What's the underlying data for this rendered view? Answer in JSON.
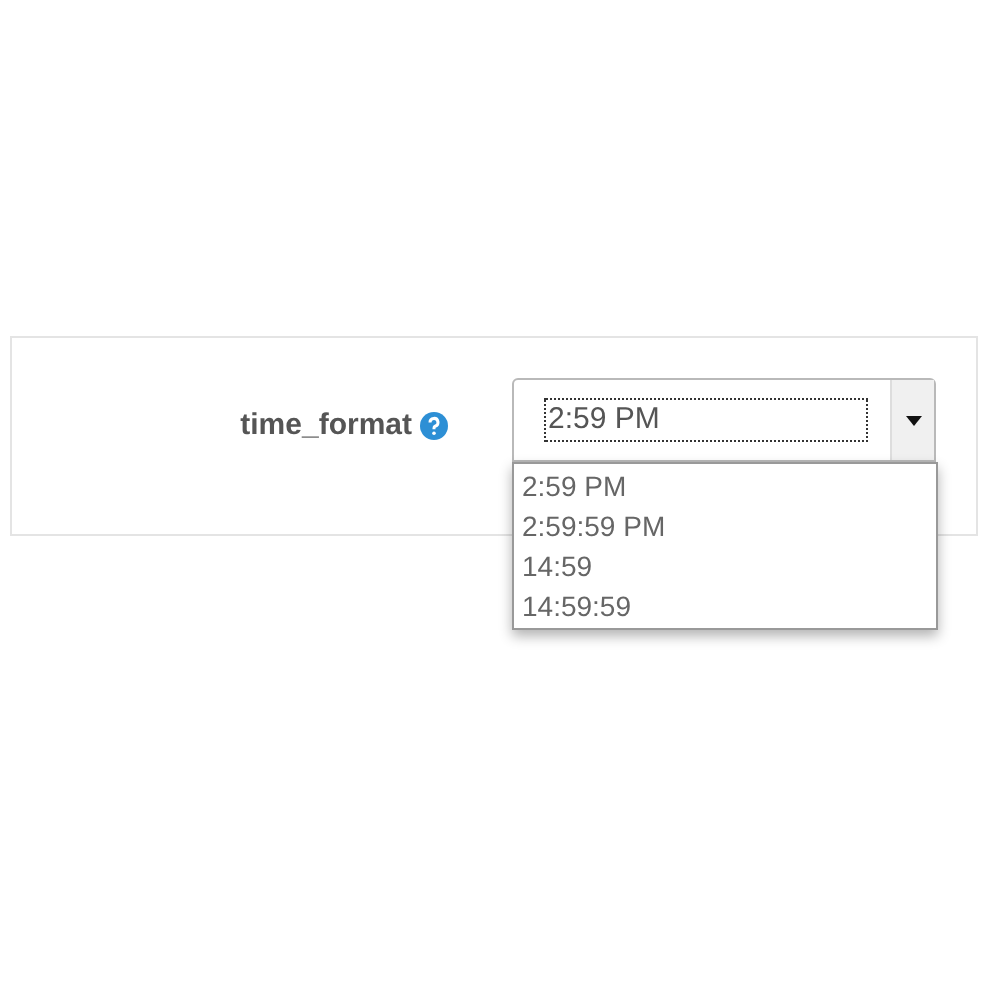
{
  "field": {
    "label": "time_format",
    "value": "2:59 PM",
    "expanded": true
  },
  "options": [
    "2:59 PM",
    "2:59:59 PM",
    "14:59",
    "14:59:59"
  ]
}
